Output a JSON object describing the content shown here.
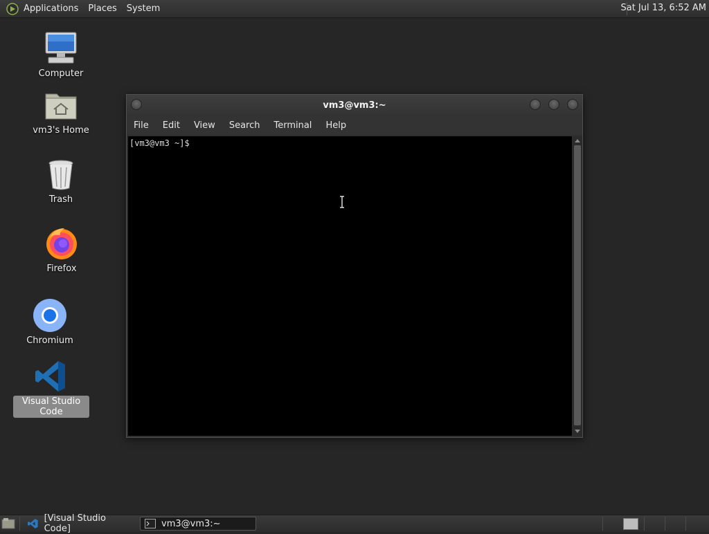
{
  "top_panel": {
    "menus": [
      "Applications",
      "Places",
      "System"
    ],
    "clock": "Sat Jul 13,  6:52 AM"
  },
  "desktop": {
    "icons": [
      {
        "label": "Computer",
        "icon": "computer-icon"
      },
      {
        "label": "vm3's Home",
        "icon": "home-folder-icon"
      },
      {
        "label": "Trash",
        "icon": "trash-icon"
      },
      {
        "label": "Firefox",
        "icon": "firefox-icon"
      },
      {
        "label": "Chromium",
        "icon": "chromium-icon"
      },
      {
        "label": "Visual Studio Code",
        "icon": "vscode-icon",
        "selected": true
      }
    ]
  },
  "terminal": {
    "title": "vm3@vm3:~",
    "menu": [
      "File",
      "Edit",
      "View",
      "Search",
      "Terminal",
      "Help"
    ],
    "prompt": "[vm3@vm3 ~]$"
  },
  "taskbar": {
    "tasks": [
      {
        "label": "[Visual Studio Code]",
        "icon": "vscode-icon",
        "active": false
      },
      {
        "label": "vm3@vm3:~",
        "icon": "terminal-icon",
        "active": true
      }
    ]
  },
  "colors": {
    "desktop_bg": "#262626",
    "panel_bg": "#333333",
    "terminal_bg": "#000000",
    "selection": "#8a8a8a"
  }
}
